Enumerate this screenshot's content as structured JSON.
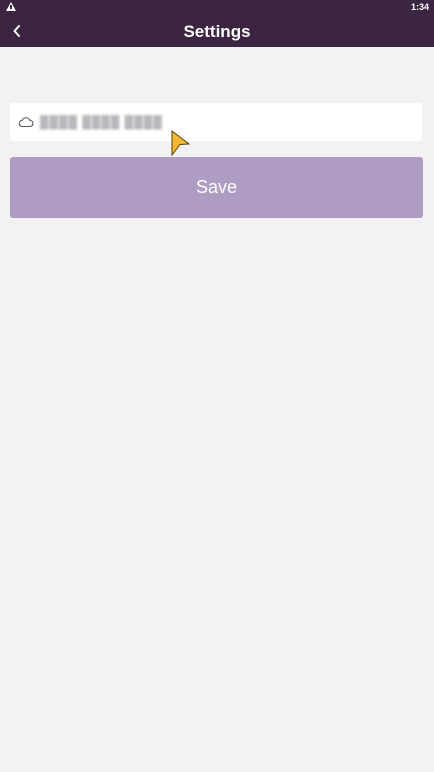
{
  "status_bar": {
    "time": "1:34",
    "alert_icon": "warning-icon"
  },
  "header": {
    "title": "Settings",
    "back_icon": "chevron-left-icon",
    "background_color": "#3b2540"
  },
  "server_field": {
    "icon": "cloud-icon",
    "value": "████ ████ ████"
  },
  "save_button": {
    "label": "Save",
    "color": "#ae9cc3"
  },
  "cursor": {
    "icon": "mouse-pointer-icon",
    "color": "#f2b733"
  }
}
